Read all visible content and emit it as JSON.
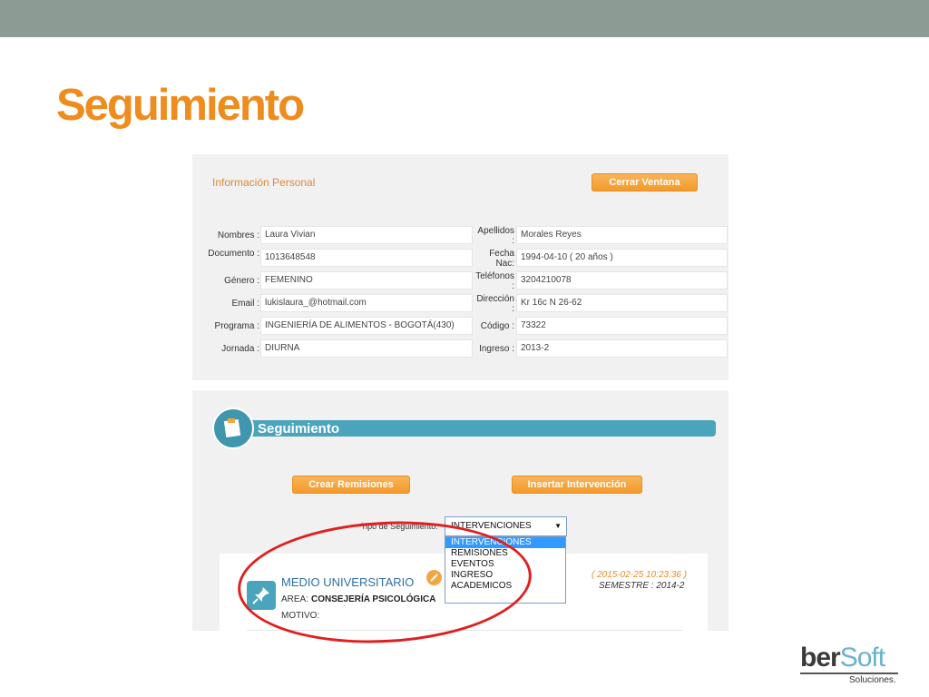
{
  "slide": {
    "title": "Seguimiento"
  },
  "info": {
    "heading": "Información Personal",
    "close_label": "Cerrar Ventana",
    "left_fields": [
      {
        "label": "Nombres :",
        "value": "Laura  Vivian"
      },
      {
        "label": "Documento :",
        "value": "1013648548"
      },
      {
        "label": "Género :",
        "value": "FEMENINO"
      },
      {
        "label": "Email :",
        "value": "lukislaura_@hotmail.com"
      },
      {
        "label": "Programa :",
        "value": "INGENIERÍA DE ALIMENTOS - BOGOTÁ(430)"
      },
      {
        "label": "Jornada :",
        "value": "DIURNA"
      }
    ],
    "right_fields": [
      {
        "label": "Apellidos :",
        "value": "Morales  Reyes"
      },
      {
        "label": "Fecha Nac:",
        "value": "1994-04-10 ( 20 años )"
      },
      {
        "label": "Teléfonos :",
        "value": "3204210078"
      },
      {
        "label": "Dirección :",
        "value": "Kr 16c N 26-62"
      },
      {
        "label": "Código :",
        "value": "73322"
      },
      {
        "label": "Ingreso :",
        "value": "2013-2"
      }
    ]
  },
  "seguimiento": {
    "bar_label": "Seguimiento",
    "btn_remisiones": "Crear Remisiones",
    "btn_intervencion": "Insertar Intervención",
    "tipo_label": "Tipo de Seguimiento:",
    "select_value": "INTERVENCIONES",
    "options": [
      "INTERVENCIONES",
      "REMISIONES",
      "EVENTOS",
      "INGRESO",
      "ACADEMICOS"
    ],
    "entry": {
      "title": "MEDIO UNIVERSITARIO",
      "area_label": "AREA:",
      "area_value": "CONSEJERÍA PSICOLÓGICA",
      "motivo": "MOTIVO:",
      "date": "( 2015-02-25 10:23:36 )",
      "semestre": "SEMESTRE : 2014-2"
    }
  },
  "logo": {
    "ber": "ber",
    "soft": "Soft",
    "sub": "Soluciones."
  },
  "colors": {
    "accent": "#ee8c1d",
    "bar": "#4aa4bb",
    "topbar": "#8c9c95",
    "highlight": "#e02020"
  }
}
